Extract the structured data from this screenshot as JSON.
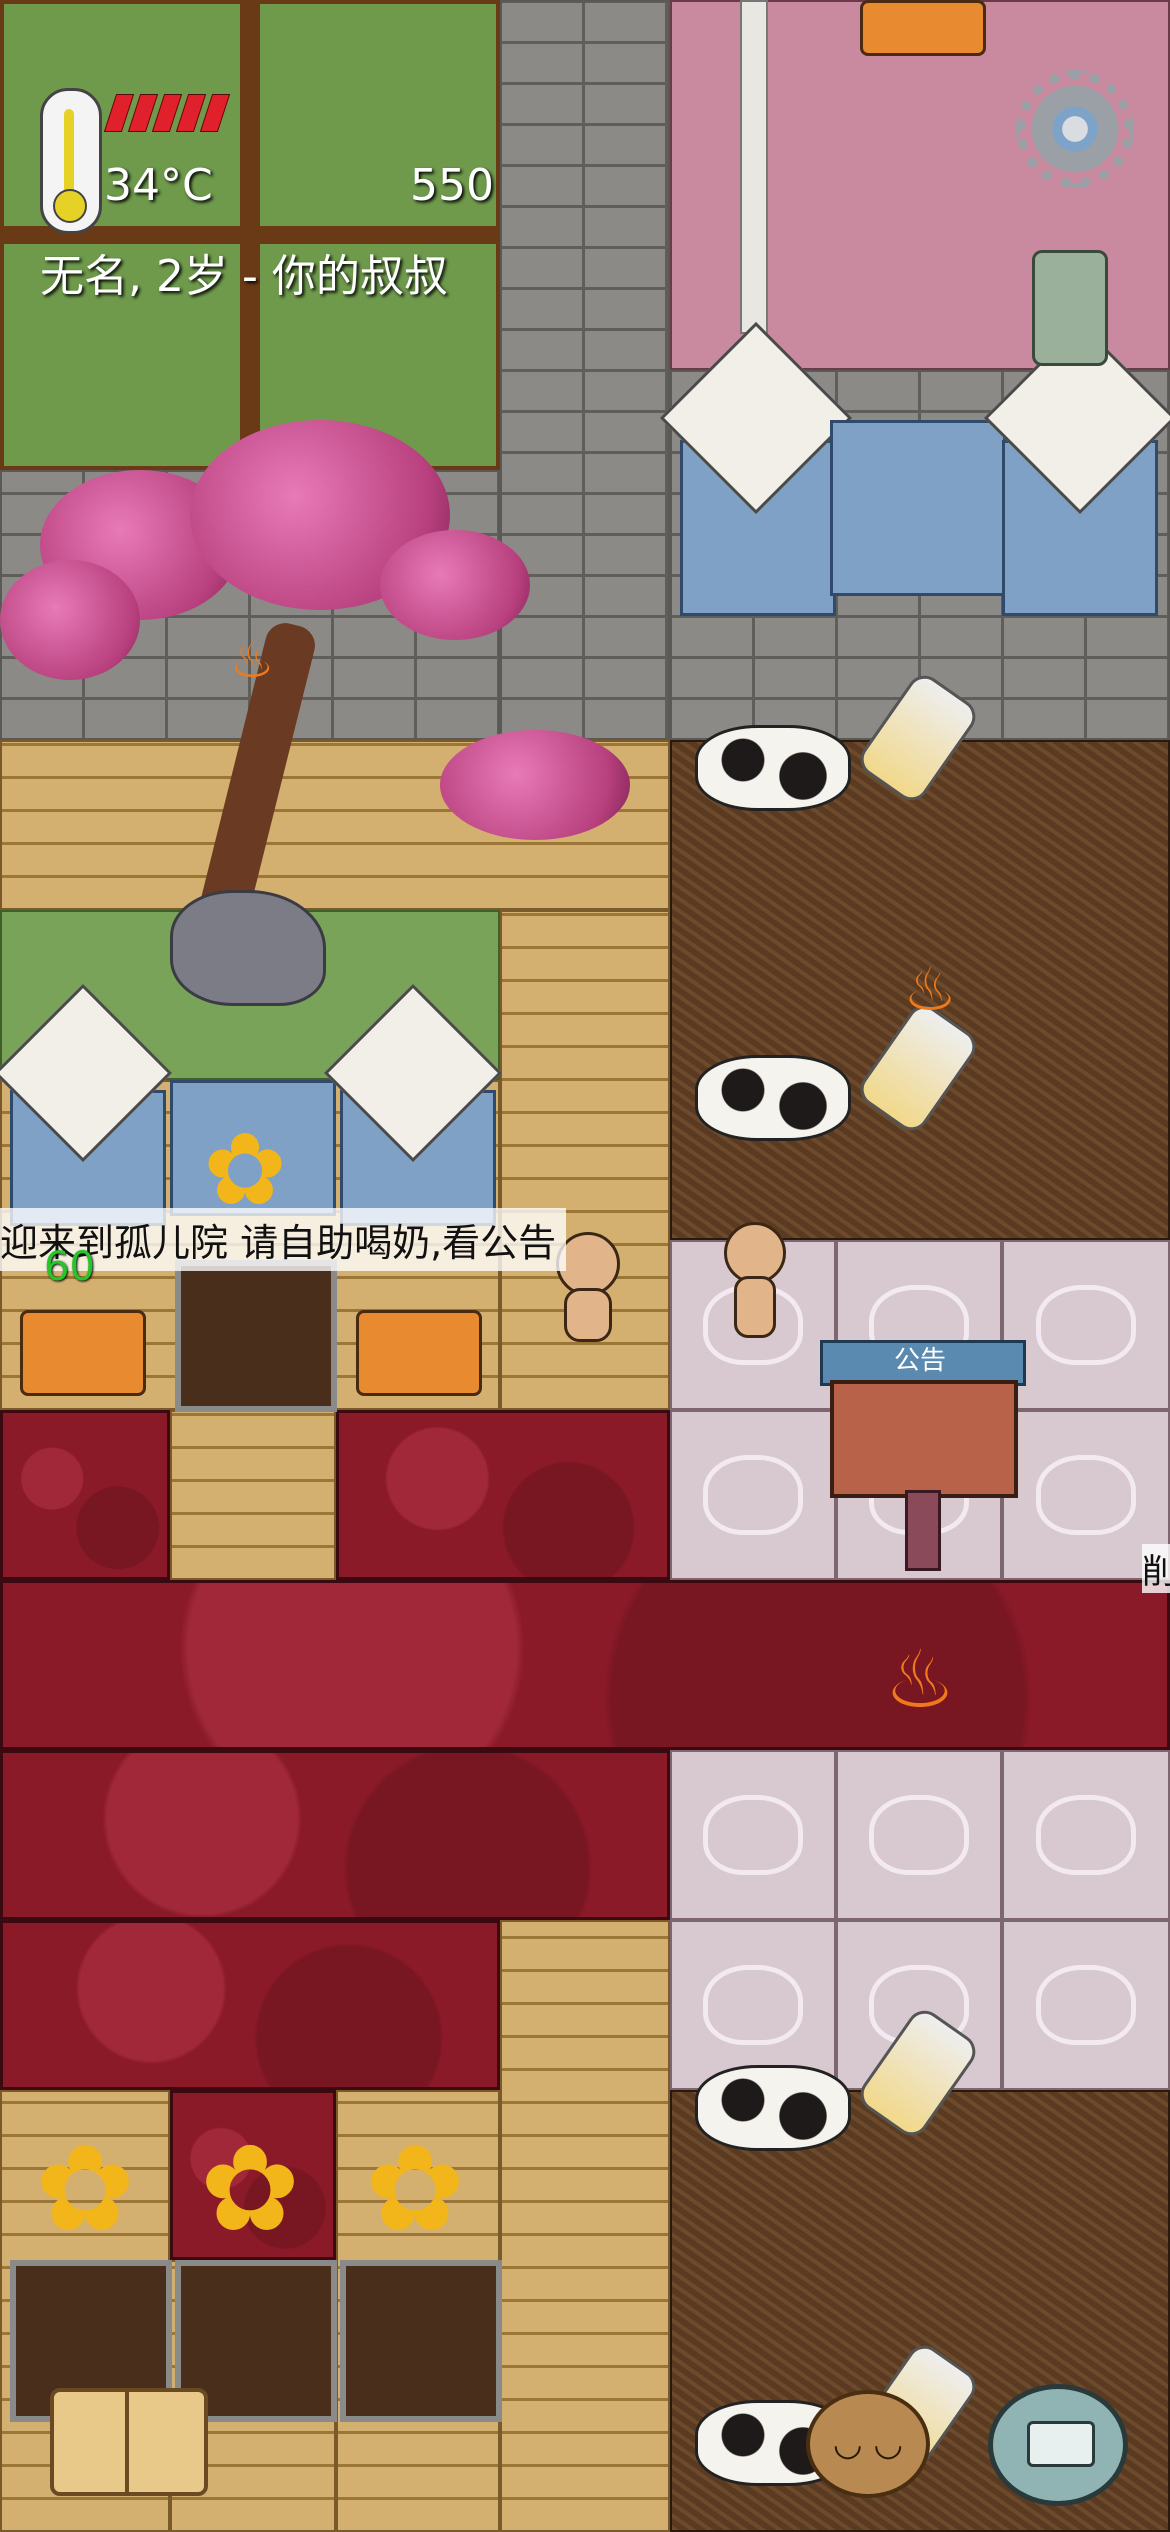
{
  "hud": {
    "temperature": "34°C",
    "score": "550",
    "status_line": "无名, 2岁 - 你的叔叔",
    "food_pips_filled": 5,
    "food_pips_total": 5,
    "colors": {
      "food": "#e0202a",
      "thermometer": "#e6d227",
      "speech_number": "#27c52a"
    }
  },
  "chat": {
    "speech_text": "迎来到孤儿院 请自助喝奶,看公告",
    "speech_number": "60",
    "edge_label": "削"
  },
  "icons": {
    "settings": "gear-icon",
    "tech_tree": "tech-tree-icon",
    "recipe_book": "book-icon",
    "emote": "potato-face-icon",
    "keyboard": "keyboard-chat-icon"
  },
  "bulletin_board": {
    "sign": "公告"
  }
}
